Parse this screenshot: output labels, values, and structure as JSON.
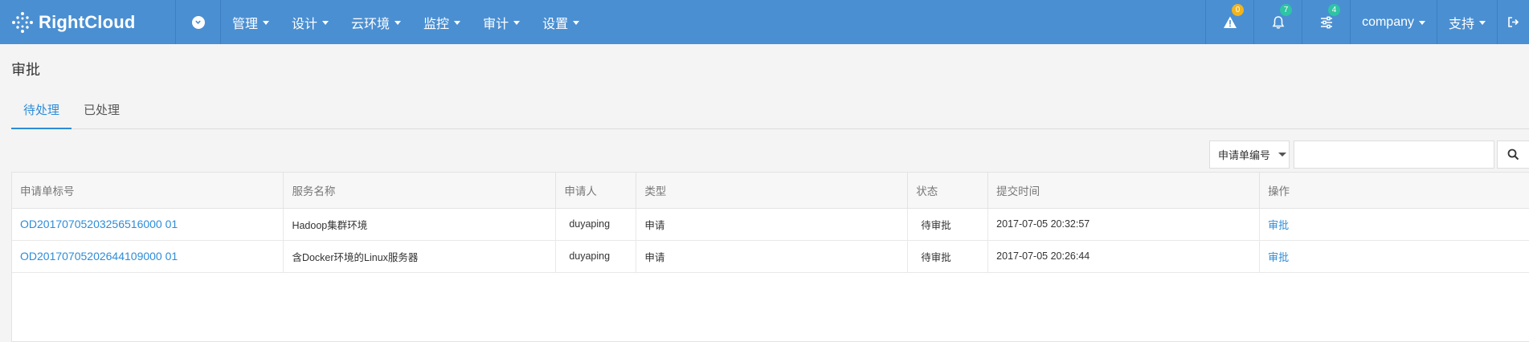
{
  "brand": {
    "name": "RightCloud"
  },
  "nav": {
    "items": [
      {
        "label": "管理"
      },
      {
        "label": "设计"
      },
      {
        "label": "云环境"
      },
      {
        "label": "监控"
      },
      {
        "label": "审计"
      },
      {
        "label": "设置"
      }
    ]
  },
  "topRight": {
    "alertCount": "0",
    "notificationCount": "7",
    "taskCount": "4",
    "company": "company",
    "support": "支持"
  },
  "colors": {
    "navBar": "#4a8fd2",
    "accent": "#2d8cd8",
    "badgeYellow": "#f0b41e",
    "badgeTeal": "#2ec4a4"
  },
  "page": {
    "title": "审批"
  },
  "tabs": [
    {
      "label": "待处理",
      "active": true
    },
    {
      "label": "已处理",
      "active": false
    }
  ],
  "search": {
    "field": "申请单编号",
    "placeholder": ""
  },
  "table": {
    "headers": [
      "申请单标号",
      "服务名称",
      "申请人",
      "类型",
      "状态",
      "提交时间",
      "操作"
    ],
    "rows": [
      [
        "OD20170705203256516000 01",
        "Hadoop集群环境",
        "duyaping",
        "申请",
        "待审批",
        "2017-07-05 20:32:57",
        "审批"
      ],
      [
        "OD20170705202644109000 01",
        "含Docker环境的Linux服务器",
        "duyaping",
        "申请",
        "待审批",
        "2017-07-05 20:26:44",
        "审批"
      ]
    ]
  }
}
